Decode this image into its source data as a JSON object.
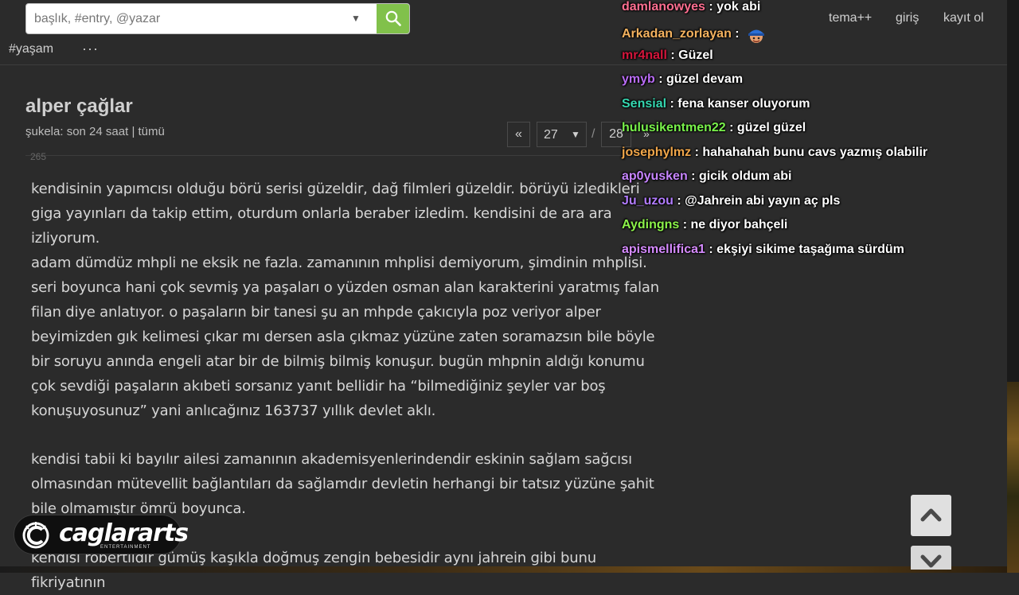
{
  "search": {
    "placeholder": "başlık, #entry, @yazar"
  },
  "topnav": {
    "tema": "tema++",
    "giris": "giriş",
    "kayit": "kayıt ol"
  },
  "channel": {
    "label": "#yaşam",
    "more": "···"
  },
  "topic": {
    "title": "alper çağlar",
    "sukela_label": "şukela:",
    "son24": "son 24 saat",
    "sep": "|",
    "tumu": "tümü"
  },
  "pager": {
    "prev": "«",
    "current": "27",
    "slash": "/",
    "last": "28",
    "next": "»"
  },
  "entry_number": "265",
  "paragraphs": [
    "kendisinin yapımcısı olduğu börü serisi güzeldir, dağ filmleri güzeldir. börüyü izledikleri giga yayınları da takip ettim, oturdum onlarla beraber izledim. kendisini de ara ara izliyorum.",
    "adam dümdüz mhpli ne eksik ne fazla. zamanının mhplisi demiyorum, şimdinin mhplisi. seri boyunca hani çok sevmiş ya paşaları o yüzden osman alan karakterini yaratmış falan filan diye anlatıyor. o paşaların bir tanesi şu an mhpde çakıcıyla poz veriyor alper beyimizden gık kelimesi çıkar mı dersen asla çıkmaz yüzüne zaten soramazsın bile böyle bir soruyu anında engeli atar bir de bilmiş bilmiş konuşur. bugün mhpnin aldığı konumu çok sevdiği paşaların akıbeti sorsanız yanıt bellidir ha “bilmediğiniz şeyler var boş konuşuyosunuz” yani anlıcağınız 163737 yıllık devlet aklı.",
    "kendisi tabii ki bayılır ailesi zamanının akademisyenlerindendir eskinin sağlam sağcısı olmasından mütevellit bağlantıları da sağlamdır devletin herhangi bir tatsız yüzüne şahit bile olmamıştır ömrü boyunca.",
    "kendisi robertlıdır gümüş kaşıkla doğmuş zengin bebesidir aynı jahrein gibi bunu fikriyatının"
  ],
  "chat": [
    {
      "user": "damlanowyes",
      "color": "#ff6f91",
      "text": ": yok abi"
    },
    {
      "user": "Arkadan_zorlayan",
      "color": "#f4b25f",
      "text": ":",
      "emote": "hat-face-emote"
    },
    {
      "user": "mr4nall",
      "color": "#d4163c",
      "text": ": Güzel"
    },
    {
      "user": "ymyb",
      "color": "#b96cf5",
      "text": ": güzel devam"
    },
    {
      "user": "Sensial",
      "color": "#35d7b0",
      "text": ": fena kanser oluyorum"
    },
    {
      "user": "hulusikentmen22",
      "color": "#79f24b",
      "text": ": güzel güzel"
    },
    {
      "user": "josephylmz",
      "color": "#f0a64a",
      "text": ": hahahahah bunu cavs yazmış olabilir"
    },
    {
      "user": "ap0yusken",
      "color": "#c785ff",
      "text": ": gicik oldum abi"
    },
    {
      "user": "Ju_uzou",
      "color": "#b27cff",
      "text": ": @Jahrein abi yayın aç pls"
    },
    {
      "user": "Aydingns",
      "color": "#8cf24a",
      "text": ": ne diyor bahçeli"
    },
    {
      "user": "apismellifica1",
      "color": "#d68bff",
      "text": ": ekşiyi sikime taşağıma sürdüm"
    }
  ],
  "logo": {
    "name": "caglararts",
    "sub": "ENTERTAINMENT"
  },
  "colors": {
    "background": "#2b2b2b",
    "search_button": "#81c14b",
    "text": "#d6d6d6"
  }
}
